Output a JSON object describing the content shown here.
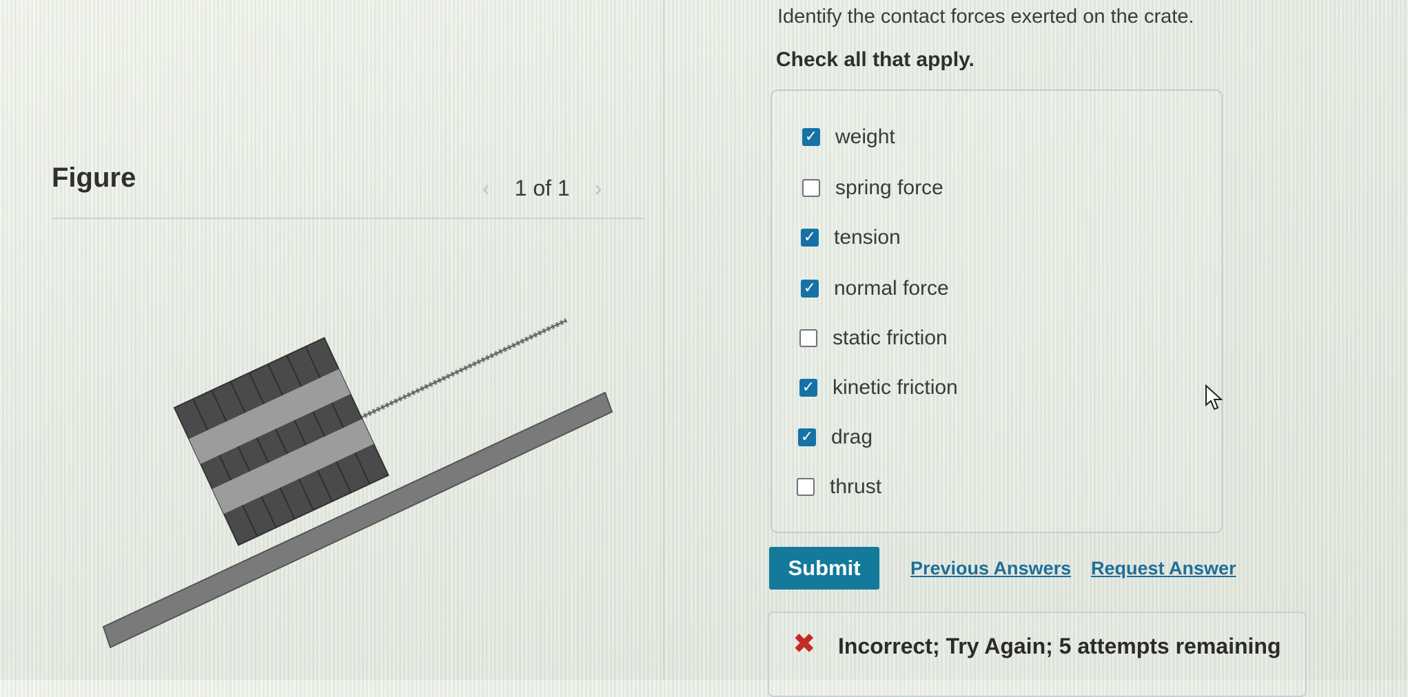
{
  "figure": {
    "title": "Figure",
    "pager": {
      "prev_icon": "chevron-left-icon",
      "label": "1 of 1",
      "next_icon": "chevron-right-icon"
    }
  },
  "question": {
    "prompt": "Identify the contact forces exerted on the crate.",
    "instruction": "Check all that apply.",
    "options": [
      {
        "label": "weight",
        "checked": true
      },
      {
        "label": "spring force",
        "checked": false
      },
      {
        "label": "tension",
        "checked": true
      },
      {
        "label": "normal force",
        "checked": true
      },
      {
        "label": "static friction",
        "checked": false
      },
      {
        "label": "kinetic friction",
        "checked": true
      },
      {
        "label": "drag",
        "checked": true
      },
      {
        "label": "thrust",
        "checked": false
      }
    ]
  },
  "actions": {
    "submit_label": "Submit",
    "previous_answers_label": "Previous Answers",
    "request_answer_label": "Request Answer"
  },
  "feedback": {
    "icon": "x-mark-icon",
    "text": "Incorrect; Try Again; 5 attempts remaining"
  },
  "colors": {
    "accent": "#147a9c",
    "checkbox_checked": "#1672a6",
    "error": "#c42a27",
    "crate_dark": "#4a4a4a",
    "ramp": "#7a7a7a"
  }
}
